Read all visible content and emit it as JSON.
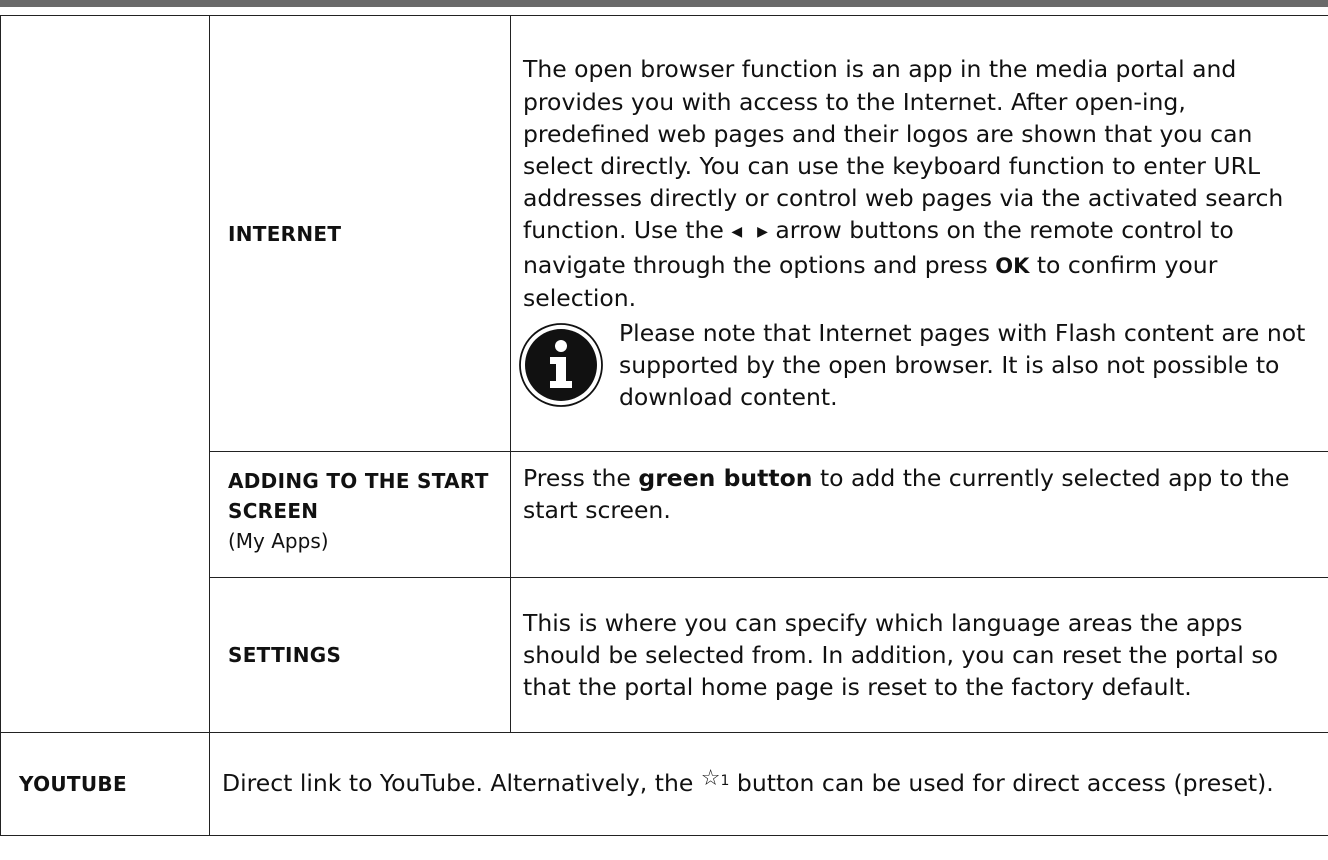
{
  "rows": {
    "internet": {
      "label": "INTERNET",
      "text_part1": "The open browser function is an app in the media portal and provides you with access to the Internet. After open-ing, predefined web pages and their logos are shown that you can select directly. You can use the keyboard function to enter URL addresses directly or control web pages via the activated search function. Use the",
      "left_arrow": "◀",
      "right_arrow": "▶",
      "text_part2": "arrow buttons on the remote control to navigate through the options and press",
      "ok_label": "OK",
      "text_part3": "to confirm your selection.",
      "note_icon": "info-icon",
      "note_text": "Please note that Internet pages with Flash content are not supported by the open browser. It is also not possible to download content."
    },
    "adding": {
      "label": "ADDING TO THE START SCREEN",
      "sublabel": "(My Apps)",
      "text_part1": "Press the",
      "bold": "green button",
      "text_part2": "to add the currently selected app to the start screen."
    },
    "settings": {
      "label": "SETTINGS",
      "text": "This is where you can specify which language areas the apps should be selected from. In addition, you can reset the portal so that the portal home page is reset to the factory default."
    },
    "youtube": {
      "label": "YOUTUBE",
      "text_part1": "Direct link to YouTube. Alternatively, the",
      "star": "☆",
      "star_index": "1",
      "text_part2": "button can be used for direct access (preset)."
    }
  },
  "colors": {
    "rule": "#6a6a6a",
    "border": "#222222",
    "icon": "#111111"
  }
}
